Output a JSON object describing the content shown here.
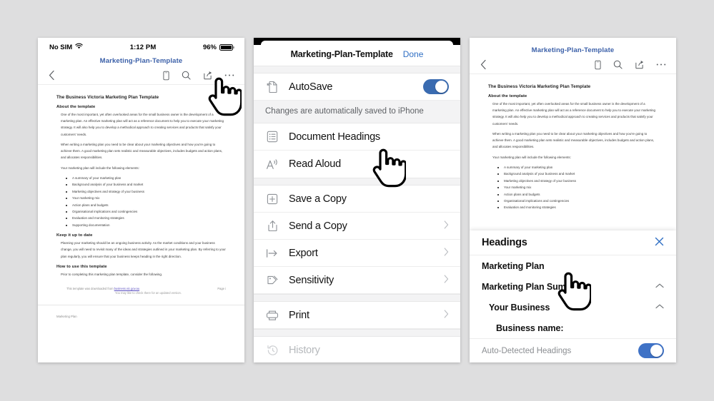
{
  "background_color": "#dededf",
  "accent_color": "#2f6fc4",
  "toggle_on_color": "#3a6bb0",
  "doc_title_color": "#3a5fa8",
  "status_bar": {
    "carrier": "No SIM",
    "wifi_icon": "wifi-icon",
    "time": "1:12 PM",
    "battery_percent": "96%"
  },
  "toolbar": {
    "doc_title": "Marketing-Plan-Template",
    "back_icon": "chevron-left-icon",
    "icons": [
      "mobile-view-icon",
      "search-icon",
      "share-icon",
      "more-options-icon"
    ]
  },
  "document": {
    "h1": "The Business Victoria Marketing Plan Template",
    "h2_about": "About the template",
    "p1": "One of the most important, yet often overlooked areas for the small business owner is the development of a marketing plan. An effective marketing plan will act as a reference document to help you to execute your marketing strategy. It will also help you to develop a methodical approach to creating services and products that satisfy your customers' needs.",
    "p2": "When writing a marketing plan you need to be clear about your marketing objectives and how you're going to achieve them. A good marketing plan sets realistic and measurable objectives, includes budgets and action plans, and allocates responsibilities.",
    "p3": "Your marketing plan will include the following elements:",
    "bullets": [
      "A summary of your marketing plan",
      "Background analysis of your business and market",
      "Marketing objectives and strategy of your business",
      "Your marketing mix",
      "Action plans and budgets",
      "Organisational implications and contingencies",
      "Evaluation and monitoring strategies",
      "Supporting documentation"
    ],
    "h2_keep": "Keep it up to date",
    "p4": "Planning your marketing should be an ongoing business activity. As the market conditions and your business change, you will need to revisit many of the ideas and strategies outlined in your marketing plan. By referring to your plan regularly, you will ensure that your business keeps heading in the right direction.",
    "h2_how": "How to use this template",
    "p5": "Prior to completing this marketing plan template, consider the following.",
    "footer_left_pre": "This template was downloaded from ",
    "footer_link": "business.vic.gov.au",
    "footer_right": "Page i",
    "footer_second_line": "You may like to check there for an updated version.",
    "running_head": "Marketing Plan"
  },
  "sheet": {
    "title": "Marketing-Plan-Template",
    "done_label": "Done",
    "autosave": {
      "icon": "autosave-document-icon",
      "label": "AutoSave",
      "toggle_state": "on",
      "note": "Changes are automatically saved to iPhone"
    },
    "items": [
      {
        "icon": "document-headings-icon",
        "label": "Document Headings",
        "chevron": false
      },
      {
        "icon": "read-aloud-icon",
        "label": "Read Aloud",
        "chevron": false
      },
      {
        "icon": "save-a-copy-icon",
        "label": "Save a Copy",
        "chevron": false
      },
      {
        "icon": "send-a-copy-icon",
        "label": "Send a Copy",
        "chevron": true
      },
      {
        "icon": "export-icon",
        "label": "Export",
        "chevron": true
      },
      {
        "icon": "sensitivity-icon",
        "label": "Sensitivity",
        "chevron": true
      },
      {
        "icon": "print-icon",
        "label": "Print",
        "chevron": true
      },
      {
        "icon": "history-icon",
        "label": "History",
        "chevron": false
      }
    ]
  },
  "headings_popover": {
    "title": "Headings",
    "close_icon": "close-icon",
    "rows": [
      {
        "label": "Marketing Plan",
        "level": 1,
        "caret": false
      },
      {
        "label": "Marketing Plan Summary",
        "level": 1,
        "caret": true
      },
      {
        "label": "Your Business",
        "level": 2,
        "caret": true
      },
      {
        "label": "Business name:",
        "level": 3,
        "caret": false
      }
    ],
    "auto_detected_label": "Auto-Detected Headings",
    "auto_detected_state": "on"
  },
  "cursors": [
    {
      "name": "pointer-on-more-options",
      "panel": 1
    },
    {
      "name": "pointer-on-document-headings",
      "panel": 2
    },
    {
      "name": "pointer-on-marketing-plan-summary",
      "panel": 3
    }
  ]
}
